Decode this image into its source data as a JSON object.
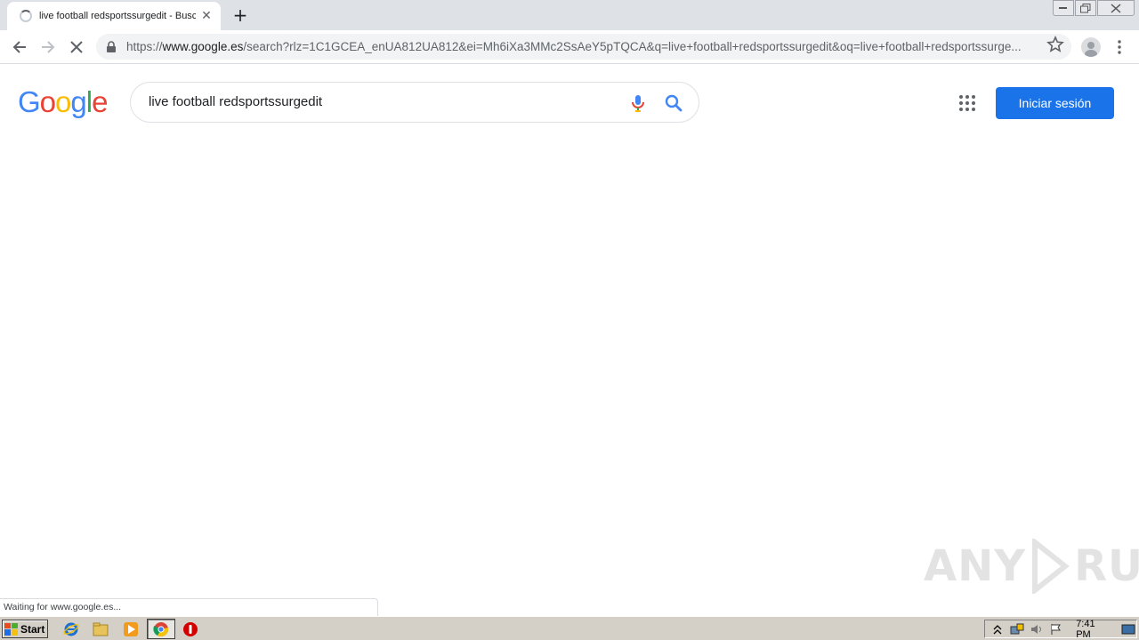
{
  "tab": {
    "title": "live football redsportssurgedit - Busc",
    "close": "✕",
    "new_tab": "+"
  },
  "toolbar": {
    "url_scheme": "https://",
    "url_host": "www.google.es",
    "url_rest": "/search?rlz=1C1GCEA_enUA812UA812&ei=Mh6iXa3MMc2SsAeY5pTQCA&q=live+football+redsportssurgedit&oq=live+football+redsportssurge..."
  },
  "google": {
    "logo_letters": [
      "G",
      "o",
      "o",
      "g",
      "l",
      "e"
    ],
    "logo_colors": [
      "#4285F4",
      "#EA4335",
      "#FBBC05",
      "#4285F4",
      "#34A853",
      "#EA4335"
    ],
    "query": "live football redsportssurgedit",
    "signin_label": "Iniciar sesión"
  },
  "status": {
    "text": "Waiting for www.google.es..."
  },
  "watermark": {
    "left": "ANY",
    "right": "RUN"
  },
  "taskbar": {
    "start_label": "Start",
    "clock": "7:41 PM"
  },
  "colors": {
    "accent": "#1a73e8",
    "tabstrip": "#dee1e6",
    "taskbar": "#d4d0c8"
  }
}
